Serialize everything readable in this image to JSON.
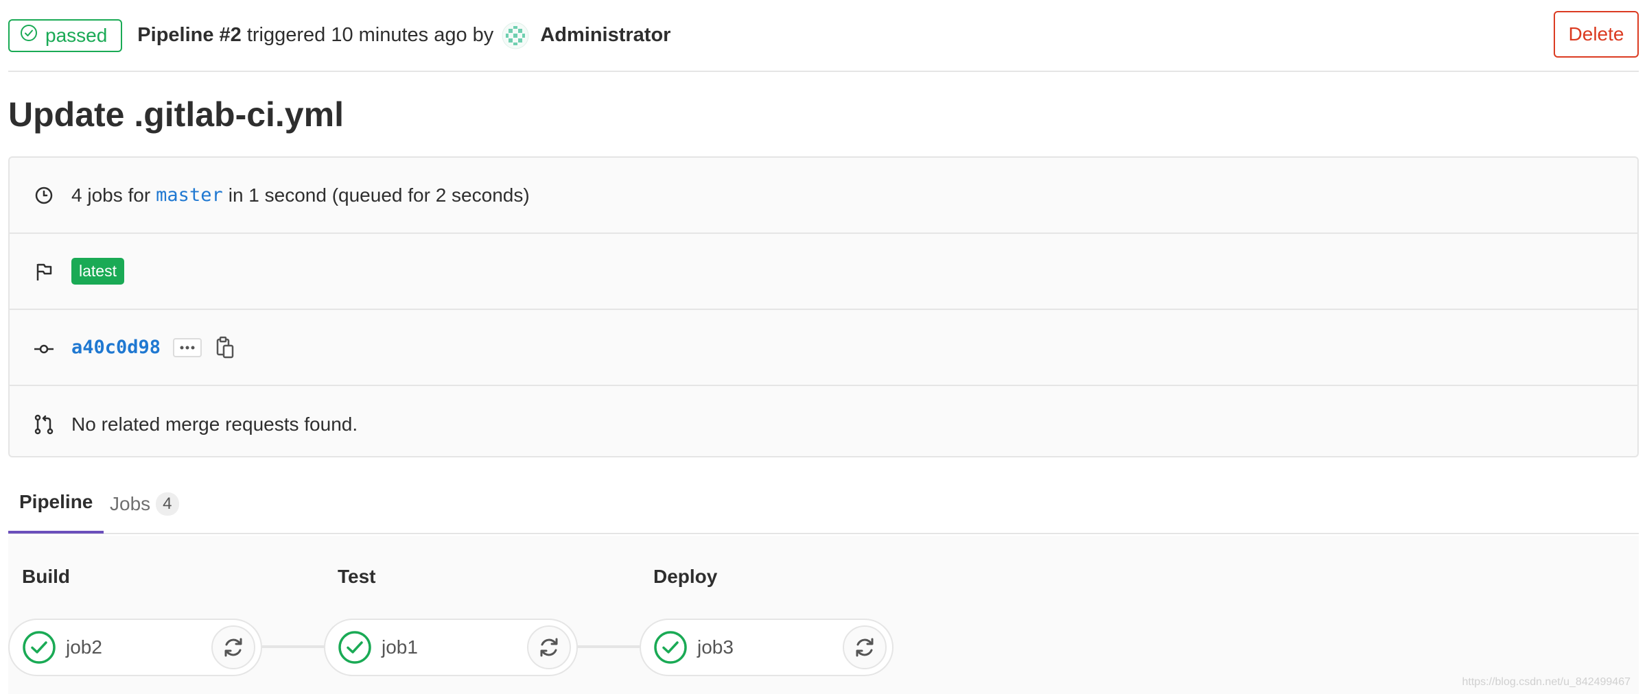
{
  "header": {
    "status": "passed",
    "pipeline_label": "Pipeline #2",
    "triggered_text": "triggered 10 minutes ago by",
    "user": "Administrator",
    "delete_label": "Delete"
  },
  "title": "Update .gitlab-ci.yml",
  "info": {
    "jobs_prefix": "4 jobs for",
    "branch": "master",
    "jobs_suffix": "in 1 second (queued for 2 seconds)",
    "latest_badge": "latest",
    "commit_sha": "a40c0d98",
    "merge_requests": "No related merge requests found."
  },
  "tabs": {
    "pipeline": "Pipeline",
    "jobs": "Jobs",
    "jobs_count": "4"
  },
  "stages": [
    {
      "title": "Build",
      "job": "job2",
      "status": "success"
    },
    {
      "title": "Test",
      "job": "job1",
      "status": "success"
    },
    {
      "title": "Deploy",
      "job": "job3",
      "status": "success"
    }
  ],
  "watermark": "https://blog.csdn.net/u_842499467",
  "colors": {
    "success": "#1aaa55",
    "danger": "#db3b21",
    "link": "#1f78d1",
    "tab_active": "#6b4fbb"
  }
}
